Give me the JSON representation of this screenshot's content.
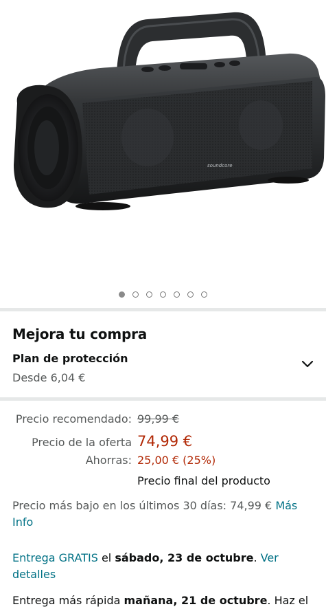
{
  "product_image": {
    "brand_text": "soundcore"
  },
  "carousel": {
    "count": 7,
    "active_index": 0
  },
  "upgrade": {
    "title": "Mejora tu compra",
    "plan_title": "Plan de protección",
    "plan_price": "Desde 6,04 €"
  },
  "pricing": {
    "recommended_label": "Precio recomendado:",
    "recommended_value": "99,99 €",
    "deal_label": "Precio de la oferta",
    "deal_value": "74,99 €",
    "savings_label": "Ahorras:",
    "savings_value": "25,00 € (25%)",
    "final_note": "Precio final del producto"
  },
  "lowest_price": {
    "text": "Precio más bajo en los últimos 30 días: 74,99 €",
    "link": "Más Info"
  },
  "delivery": {
    "free_link": "Entrega GRATIS",
    "the": "el",
    "date": "sábado, 23 de octubre",
    "period": ".",
    "details_link": "Ver detalles"
  },
  "faster_delivery": {
    "prefix": "Entrega más rápida",
    "date": "mañana, 21 de octubre",
    "suffix": ". Haz el"
  },
  "colors": {
    "price_red": "#b12704",
    "link_teal": "#007185",
    "muted_gray": "#565959"
  }
}
